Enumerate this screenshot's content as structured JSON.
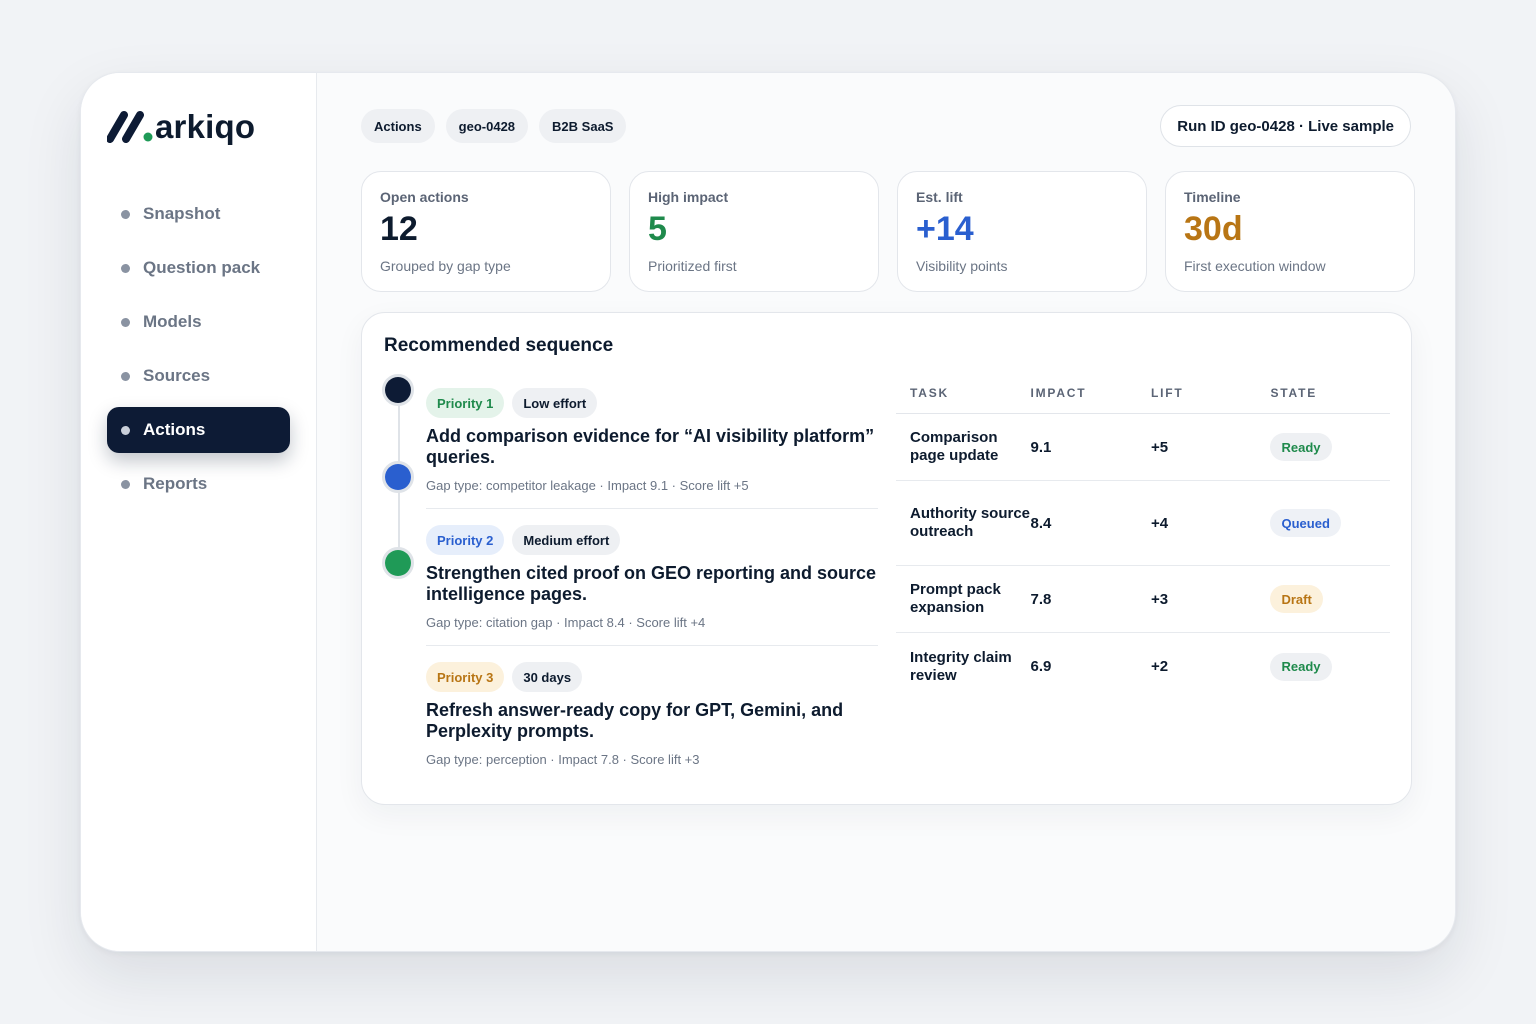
{
  "brand": {
    "name": "arkiqo"
  },
  "sidebar": {
    "items": [
      {
        "label": "Snapshot",
        "active": false
      },
      {
        "label": "Question pack",
        "active": false
      },
      {
        "label": "Models",
        "active": false
      },
      {
        "label": "Sources",
        "active": false
      },
      {
        "label": "Actions",
        "active": true
      },
      {
        "label": "Reports",
        "active": false
      }
    ]
  },
  "header": {
    "chips": [
      "Actions",
      "geo-0428",
      "B2B SaaS"
    ],
    "run_id": "Run ID geo-0428 · Live sample"
  },
  "stats": [
    {
      "label": "Open actions",
      "value": "12",
      "caption": "Grouped by gap type",
      "color": "#0d1b2e"
    },
    {
      "label": "High impact",
      "value": "5",
      "caption": "Prioritized first",
      "color": "#1f8a4c"
    },
    {
      "label": "Est. lift",
      "value": "+14",
      "caption": "Visibility points",
      "color": "#2a5fcf"
    },
    {
      "label": "Timeline",
      "value": "30d",
      "caption": "First execution window",
      "color": "#b87514"
    }
  ],
  "sequence": {
    "title": "Recommended sequence",
    "steps": [
      {
        "priority": "Priority 1",
        "effort": "Low effort",
        "title": "Add comparison evidence for “AI visibility platform” queries.",
        "meta": "Gap type: competitor leakage · Impact 9.1 · Score lift +5"
      },
      {
        "priority": "Priority 2",
        "effort": "Medium effort",
        "title": "Strengthen cited proof on GEO reporting and source intelligence pages.",
        "meta": "Gap type: citation gap · Impact 8.4 · Score lift +4"
      },
      {
        "priority": "Priority 3",
        "effort": "30 days",
        "title": "Refresh answer-ready copy for GPT, Gemini, and Perplexity prompts.",
        "meta": "Gap type: perception · Impact 7.8 · Score lift +3"
      }
    ],
    "timeline_colors": [
      "#0d1b35",
      "#2a5fcf",
      "#1f9a57"
    ]
  },
  "table": {
    "headers": {
      "task": "TASK",
      "impact": "IMPACT",
      "lift": "LIFT",
      "state": "STATE"
    },
    "rows": [
      {
        "task": "Comparison page update",
        "impact": "9.1",
        "lift": "+5",
        "state": "Ready"
      },
      {
        "task": "Authority source outreach",
        "impact": "8.4",
        "lift": "+4",
        "state": "Queued"
      },
      {
        "task": "Prompt pack expansion",
        "impact": "7.8",
        "lift": "+3",
        "state": "Draft"
      },
      {
        "task": "Integrity claim review",
        "impact": "6.9",
        "lift": "+2",
        "state": "Ready"
      }
    ]
  }
}
